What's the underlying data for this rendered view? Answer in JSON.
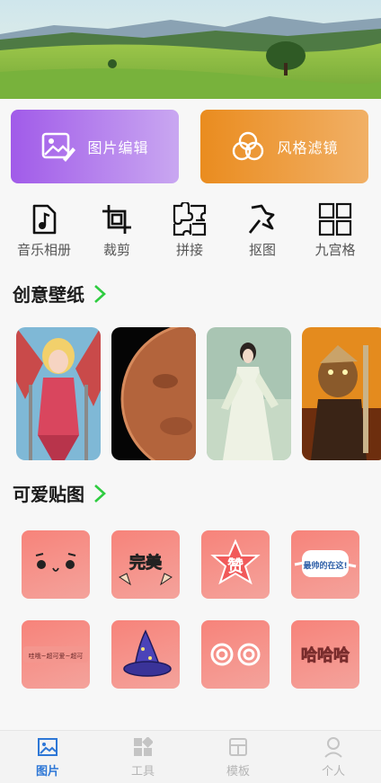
{
  "banner": {
    "image": "landscape-banner"
  },
  "actions": [
    {
      "label": "图片编辑",
      "icon": "image-edit-icon"
    },
    {
      "label": "风格滤镜",
      "icon": "filter-circles-icon"
    }
  ],
  "tools": [
    {
      "label": "音乐相册",
      "icon": "music-note-icon"
    },
    {
      "label": "裁剪",
      "icon": "crop-icon"
    },
    {
      "label": "拼接",
      "icon": "puzzle-icon"
    },
    {
      "label": "抠图",
      "icon": "cutout-icon"
    },
    {
      "label": "九宫格",
      "icon": "grid-icon"
    }
  ],
  "wallpaper_section": {
    "title": "创意壁纸"
  },
  "wallpapers": [
    "anime-warrior",
    "planet-mars",
    "hanfu-girl",
    "game-hero"
  ],
  "sticker_section": {
    "title": "可爱贴图"
  },
  "stickers": [
    {
      "name": "cute-face"
    },
    {
      "name": "wanmei",
      "text": "完美"
    },
    {
      "name": "zan",
      "text": "赞"
    },
    {
      "name": "zuishuaide",
      "text": "最帅的在这!"
    },
    {
      "name": "banner-text",
      "text": "哇哦~超可爱~超可"
    },
    {
      "name": "wizard-hat"
    },
    {
      "name": "spiral-eyes"
    },
    {
      "name": "hahaha",
      "text": "哈哈哈"
    }
  ],
  "nav": [
    {
      "label": "图片",
      "icon": "image-icon",
      "active": true
    },
    {
      "label": "工具",
      "icon": "tools-grid-icon",
      "active": false
    },
    {
      "label": "模板",
      "icon": "template-icon",
      "active": false
    },
    {
      "label": "个人",
      "icon": "person-icon",
      "active": false
    }
  ],
  "colors": {
    "accent": "#2d77d6",
    "edit_card": "#a15be9",
    "filter_card": "#ea8c1f",
    "sticker_bg": "#f7837a",
    "more_arrow": "#2ecc40"
  }
}
